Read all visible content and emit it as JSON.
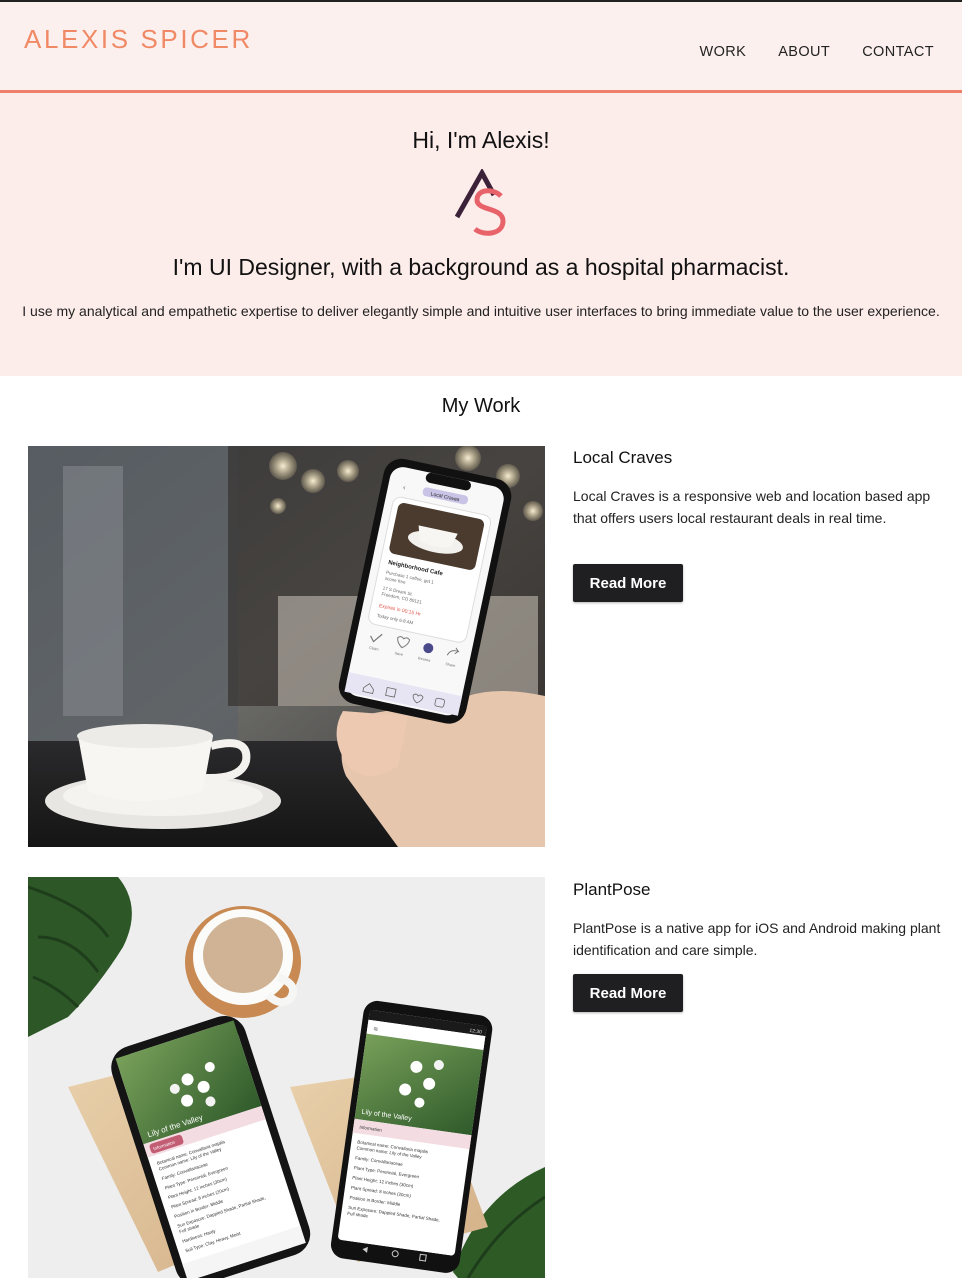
{
  "header": {
    "logo": "ALEXIS SPICER",
    "nav": [
      "WORK",
      "ABOUT",
      "CONTACT"
    ]
  },
  "hero": {
    "greeting": "Hi, I'm Alexis!",
    "monogram_letters": "AS",
    "title": "I'm UI Designer, with a background as a hospital pharmacist.",
    "description": "I use my analytical and empathetic expertise to deliver elegantly simple and intuitive user interfaces to bring immediate value to the user experience."
  },
  "work": {
    "heading": "My Work",
    "projects": [
      {
        "title": "Local Craves",
        "description": "Local Craves is a responsive web and location based app that offers users local restaurant deals in real time.",
        "button": "Read More",
        "mockup": {
          "tag": "Local Craves",
          "card_title": "Neighborhood Cafe",
          "line1": "Purchase 1 coffee, get 1",
          "line2": "scone free",
          "addr1": "17 S Dream St.",
          "addr2": "Freedom, CO 80121",
          "expires": "Expires in 00:15 Hr",
          "today": "Today only 6-8 AM",
          "actions": [
            "Claim",
            "Save",
            "Review",
            "Share"
          ]
        }
      },
      {
        "title": "PlantPose",
        "description": "PlantPose is a native app for iOS and Android making plant identification and care simple.",
        "button": "Read More",
        "mockup": {
          "plant_name": "Lily of the Valley",
          "tab": "Information",
          "details": [
            "Botanical name: Convallaria majalis",
            "Common name: Lily of the Valley",
            "Family: Convallariaceae",
            "Plant Type: Perennial, Evergreen",
            "Plant Height: 12 inches (30cm)",
            "Plant Spread: 8 inches (20cm)",
            "Position in Border: Middle",
            "Sun Exposure: Dappled Shade, Partial Shade,",
            "Full shade",
            "Hardiness: Hardy",
            "Soil Type: Clay, Heavy, Moist"
          ],
          "status_time": "12:30"
        }
      }
    ]
  },
  "colors": {
    "accent": "#ee7f6a",
    "logo": "#f08a66",
    "header_bg": "#fcf0ee",
    "hero_bg": "#fcecea",
    "button_bg": "#1f1f22",
    "monogram_a": "#3b2238",
    "monogram_s": "#e8626a"
  }
}
